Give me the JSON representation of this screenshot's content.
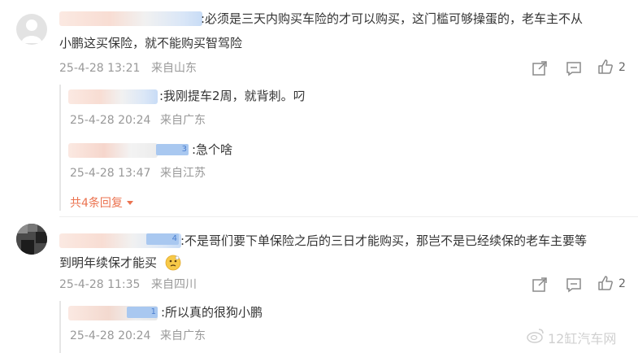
{
  "comments": [
    {
      "text_line1": ":必须是三天内购买车险的才可以购买，这门槛可够操蛋的，老车主不从",
      "text_line2": "小鹏这买保险，就不能购买智驾险",
      "date": "25-4-28 13:21",
      "location": "来自山东",
      "like_count": "2",
      "replies": [
        {
          "text": ":我刚提车2周，就背刺。叼",
          "date": "25-4-28 20:24",
          "location": "来自广东"
        },
        {
          "badge": "3",
          "text": ":急个啥",
          "date": "25-4-28 13:47",
          "location": "来自江苏"
        }
      ],
      "more_replies": "共4条回复"
    },
    {
      "badge": "4",
      "text_line1": ":不是哥们要下单保险之后的三日才能购买，那岂不是已经续保的老车主要等",
      "text_line2": "到明年续保才能买",
      "date": "25-4-28 11:35",
      "location": "来自四川",
      "like_count": "2",
      "replies": [
        {
          "badge": "1",
          "text": ":所以真的很狗小鹏",
          "date": "25-4-28 20:24",
          "location": "来自广东"
        }
      ]
    }
  ],
  "watermark": "12缸汽车网",
  "icons": {
    "share": "share-icon",
    "comment": "comment-icon",
    "like": "like-icon",
    "emoji": "thinking-face-emoji",
    "weibo": "weibo-logo-icon"
  },
  "colors": {
    "accent": "#eb7350",
    "meta": "#999999",
    "text": "#333333"
  }
}
